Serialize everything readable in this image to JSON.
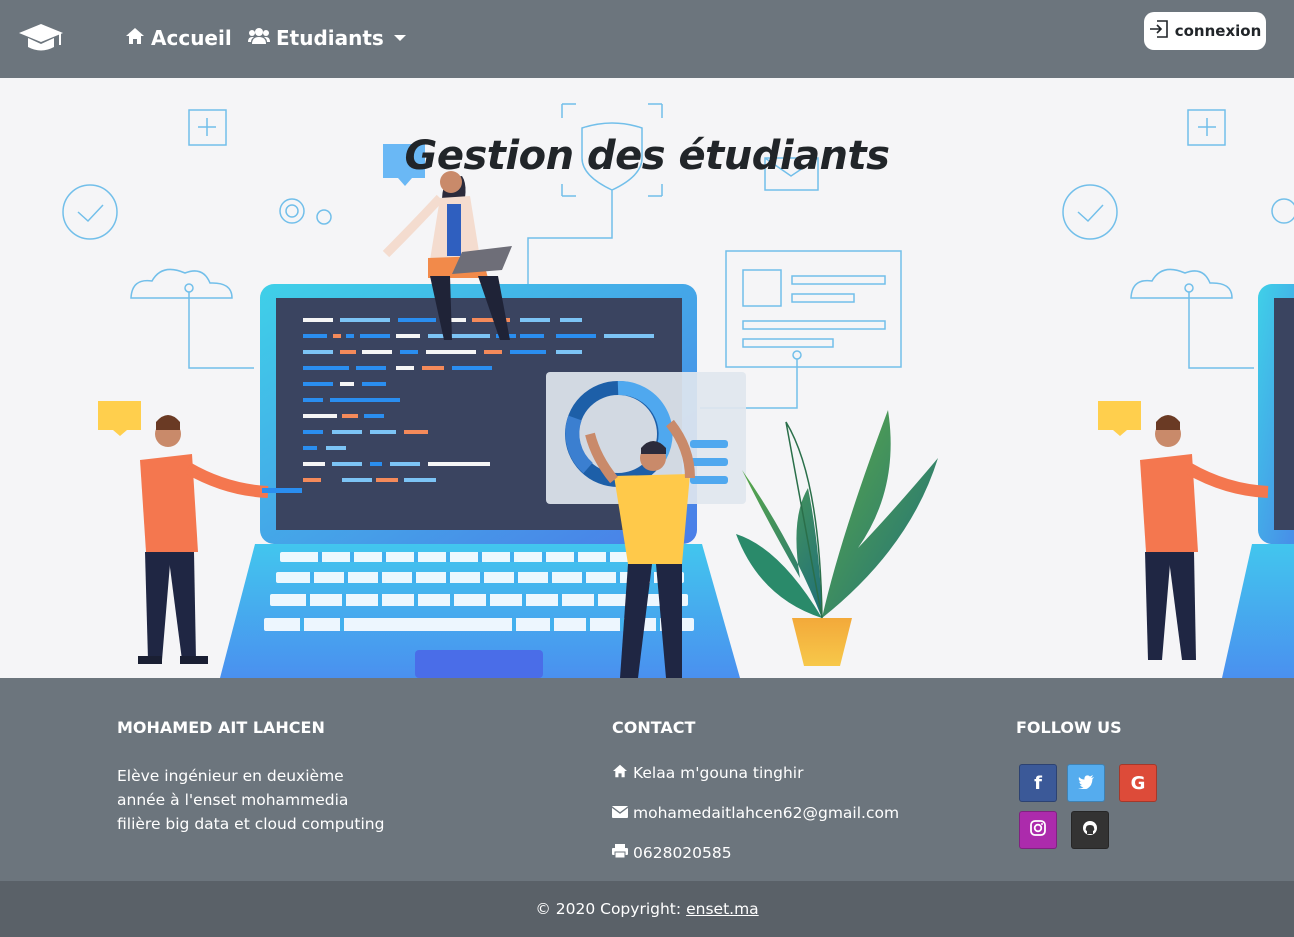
{
  "nav": {
    "brand_icon": "graduation-cap-icon",
    "accueil_label": "Accueil",
    "etudiants_label": "Etudiants",
    "connexion_label": "connexion"
  },
  "hero": {
    "title": "Gestion des étudiants"
  },
  "footer": {
    "about_title": "MOHAMED AIT LAHCEN",
    "about_lines": [
      "Elève ingénieur en deuxième",
      "année à l'enset mohammedia",
      "filière big data et cloud computing"
    ],
    "contact_title": "CONTACT",
    "address": "Kelaa m'gouna tinghir",
    "email": "mohamedaitlahcen62@gmail.com",
    "phone": "0628020585",
    "follow_title": "FOLLOW US",
    "social": [
      {
        "name": "facebook",
        "glyph": "f",
        "color": "#3b5998"
      },
      {
        "name": "twitter",
        "glyph": "t",
        "color": "#55acee"
      },
      {
        "name": "google",
        "glyph": "G",
        "color": "#dd4b39"
      },
      {
        "name": "instagram",
        "glyph": "◎",
        "color": "#ac2bac"
      },
      {
        "name": "github",
        "glyph": "●",
        "color": "#333333"
      }
    ]
  },
  "copyright": {
    "text": "© 2020 Copyright:",
    "link": "enset.ma"
  }
}
